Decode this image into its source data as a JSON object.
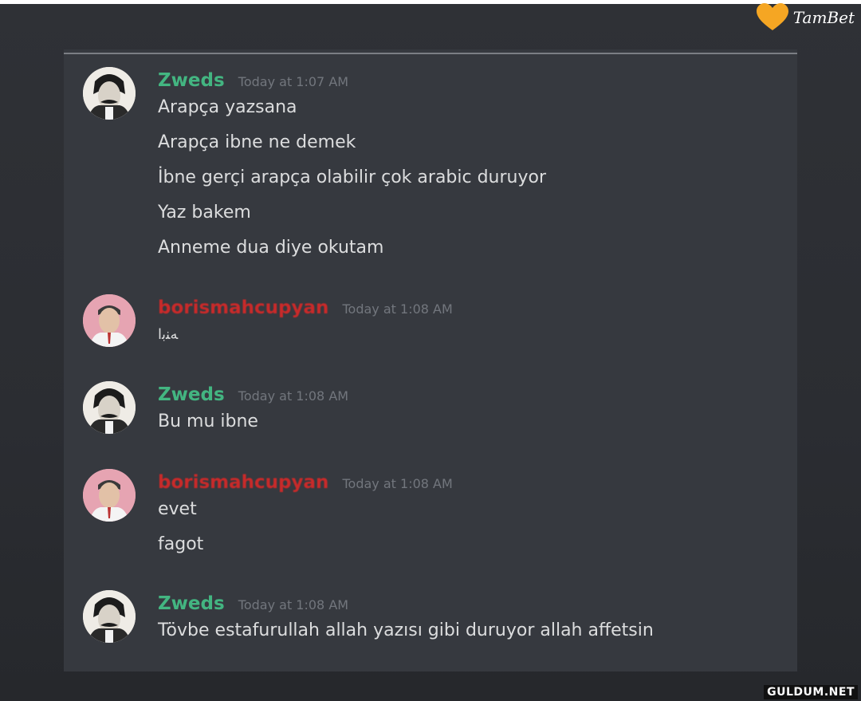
{
  "brand": {
    "logo_text": "TamBet",
    "watermark": "GULDUM.NET"
  },
  "messages": [
    {
      "author": "Zweds",
      "time": "Today at 1:07 AM",
      "lines": [
        "Arapça yazsana",
        "Arapça ibne ne demek",
        "İbne gerçi arapça olabilir çok arabic duruyor",
        "Yaz bakem",
        "Anneme dua diye okutam"
      ]
    },
    {
      "author": "borismahcupyan",
      "time": "Today at 1:08 AM",
      "lines": [
        "ﻪﻨﺑﺍ"
      ]
    },
    {
      "author": "Zweds",
      "time": "Today at 1:08 AM",
      "lines": [
        "Bu mu ibne"
      ]
    },
    {
      "author": "borismahcupyan",
      "time": "Today at 1:08 AM",
      "lines": [
        "evet",
        "fagot"
      ]
    },
    {
      "author": "Zweds",
      "time": "Today at 1:08 AM",
      "lines": [
        "Tövbe estafurullah allah yazısı gibi duruyor allah affetsin"
      ]
    }
  ],
  "colors": {
    "zweds": "#43b581",
    "boris": "#c82a2a",
    "background": "#36393f",
    "logo_heart": "#f5a623"
  }
}
